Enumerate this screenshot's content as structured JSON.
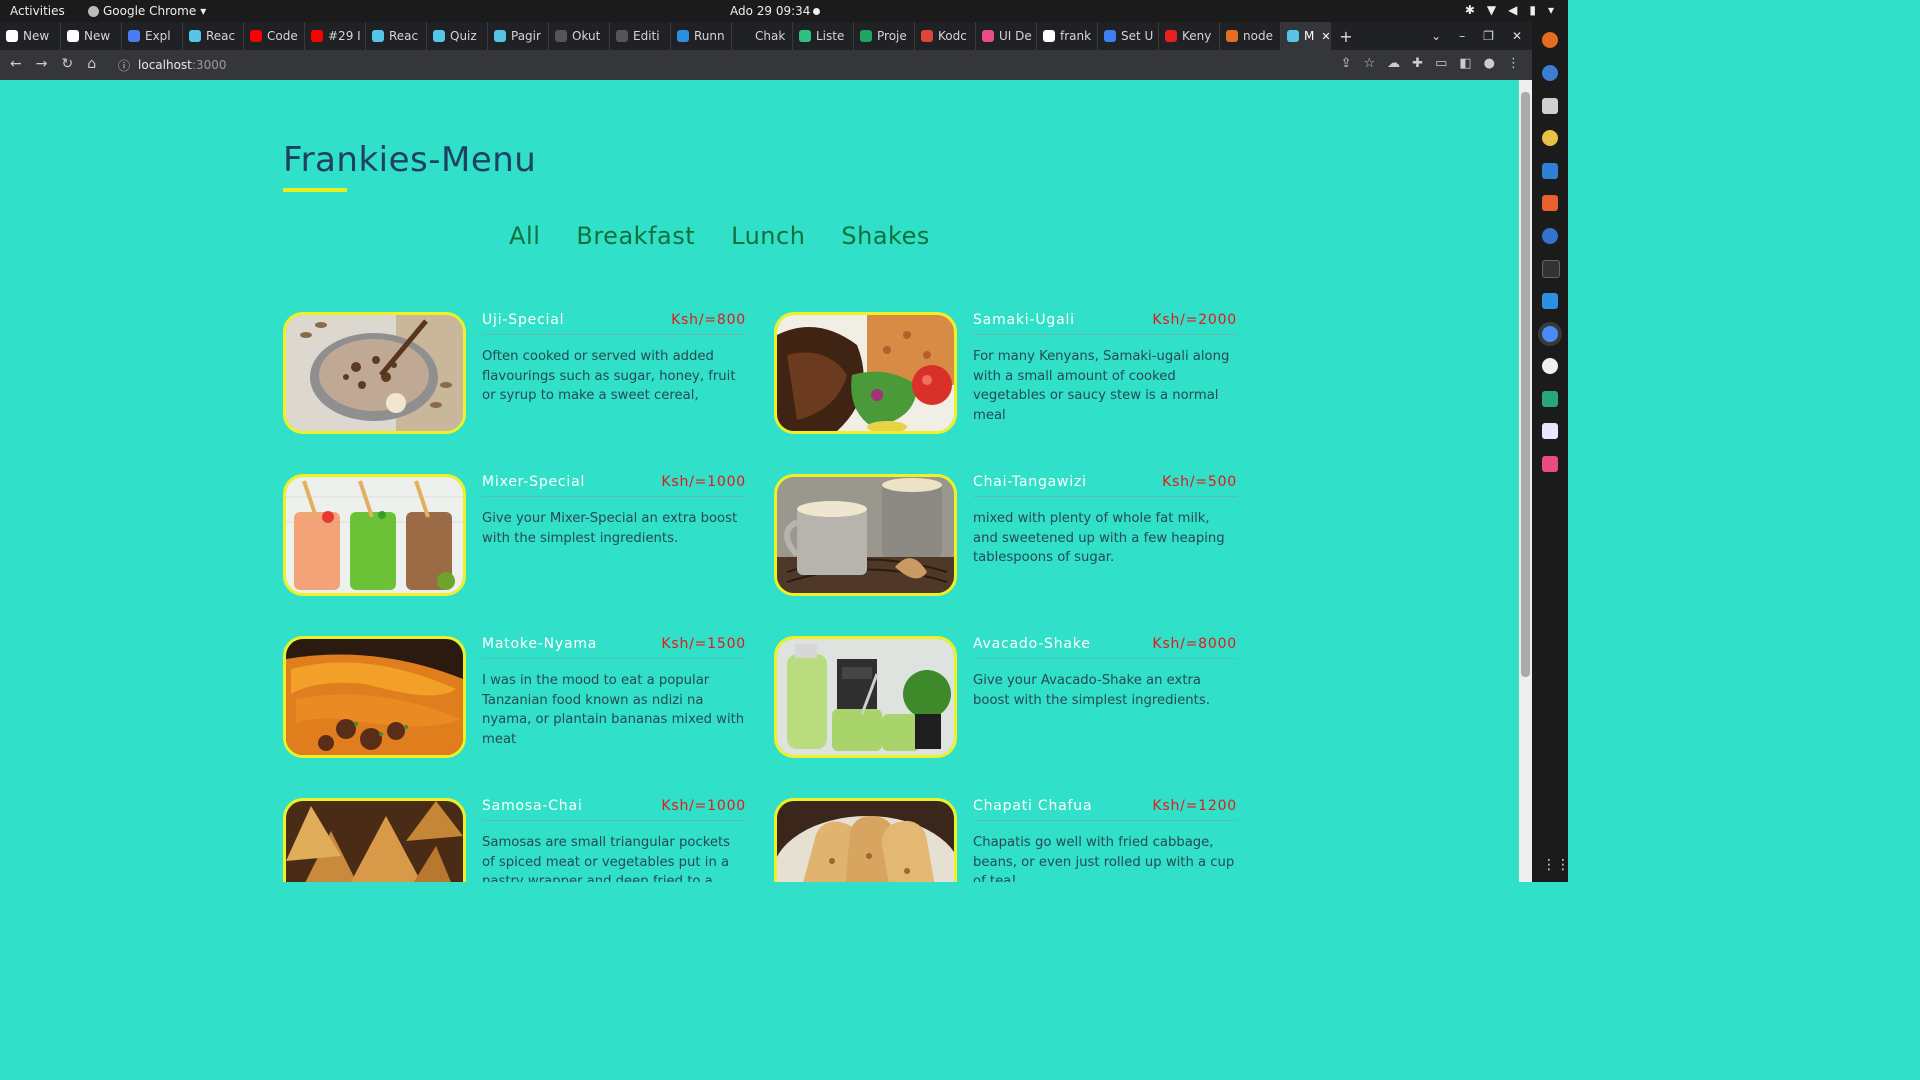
{
  "os": {
    "activities_label": "Activities",
    "app_label": "Google Chrome",
    "clock": "Ado 29  09:34"
  },
  "browser": {
    "tabs": [
      {
        "label": "New",
        "icon": "chrome-icon",
        "color": "#ffffff"
      },
      {
        "label": "New",
        "icon": "chrome-icon",
        "color": "#ffffff"
      },
      {
        "label": "Expl",
        "icon": "meta-icon",
        "color": "#4a7cf6"
      },
      {
        "label": "Reac",
        "icon": "react-icon",
        "color": "#56c6e8"
      },
      {
        "label": "Code",
        "icon": "youtube-icon",
        "color": "#ff0000"
      },
      {
        "label": "#29 I",
        "icon": "youtube-icon",
        "color": "#ff0000"
      },
      {
        "label": "Reac",
        "icon": "react-icon",
        "color": "#56c6e8"
      },
      {
        "label": "Quiz",
        "icon": "react-icon",
        "color": "#56c6e8"
      },
      {
        "label": "Pagir",
        "icon": "react-icon",
        "color": "#56c6e8"
      },
      {
        "label": "Okut",
        "icon": "github-icon",
        "color": "#555555"
      },
      {
        "label": "Editi",
        "icon": "github-icon",
        "color": "#555555"
      },
      {
        "label": "Runn",
        "icon": "vscode-icon",
        "color": "#2d8fe0"
      },
      {
        "label": "Chak",
        "icon": "blank-icon",
        "color": "#202124"
      },
      {
        "label": "Liste",
        "icon": "dot-icon",
        "color": "#2ec27e"
      },
      {
        "label": "Proje",
        "icon": "sheets-icon",
        "color": "#1fa463"
      },
      {
        "label": "Kodc",
        "icon": "kodc-icon",
        "color": "#e0453a"
      },
      {
        "label": "UI De",
        "icon": "dribbble-icon",
        "color": "#ea4c89"
      },
      {
        "label": "frank",
        "icon": "vercel-icon",
        "color": "#ffffff"
      },
      {
        "label": "Set U",
        "icon": "flag-icon",
        "color": "#3d7ef5"
      },
      {
        "label": "Keny",
        "icon": "swoosh-icon",
        "color": "#e82020"
      },
      {
        "label": "node",
        "icon": "node-icon",
        "color": "#e86d20"
      }
    ],
    "active_tab": {
      "label": "M",
      "icon": "react-icon",
      "color": "#56c6e8"
    },
    "url_host": "localhost",
    "url_port": ":3000"
  },
  "menu": {
    "title": "Frankies-Menu",
    "filters": [
      "All",
      "Breakfast",
      "Lunch",
      "Shakes"
    ],
    "items": [
      {
        "name": "Uji-Special",
        "price": "Ksh/=800",
        "desc": "Often cooked or served with added flavourings such as sugar, honey, fruit or syrup to make a sweet cereal,",
        "photo": "uji-bowl"
      },
      {
        "name": "Samaki-Ugali",
        "price": "Ksh/=2000",
        "desc": "For many Kenyans, Samaki-ugali along with a small amount of cooked vegetables or saucy stew is a normal meal",
        "photo": "fish-plate"
      },
      {
        "name": "Mixer-Special",
        "price": "Ksh/=1000",
        "desc": "Give your Mixer-Special an extra boost with the simplest ingredients.",
        "photo": "three-smoothies"
      },
      {
        "name": "Chai-Tangawizi",
        "price": "Ksh/=500",
        "desc": "mixed with plenty of whole fat milk, and sweetened up with a few heaping tablespoons of sugar.",
        "photo": "tea-mugs"
      },
      {
        "name": "Matoke-Nyama",
        "price": "Ksh/=1500",
        "desc": "I was in the mood to eat a popular Tanzanian food known as ndizi na nyama, or plantain bananas mixed with meat",
        "photo": "plantain-meat"
      },
      {
        "name": "Avacado-Shake",
        "price": "Ksh/=8000",
        "desc": "Give your Avacado-Shake an extra boost with the simplest ingredients.",
        "photo": "green-shakes"
      },
      {
        "name": "Samosa-Chai",
        "price": "Ksh/=1000",
        "desc": "Samosas are small triangular pockets of spiced meat or vegetables put in a pastry wrapper and deep fried to a",
        "photo": "samosas"
      },
      {
        "name": "Chapati Chafua",
        "price": "Ksh/=1200",
        "desc": "Chapatis go well with fried cabbage, beans, or even just rolled up with a cup of tea!",
        "photo": "chapati-rolls"
      }
    ]
  }
}
